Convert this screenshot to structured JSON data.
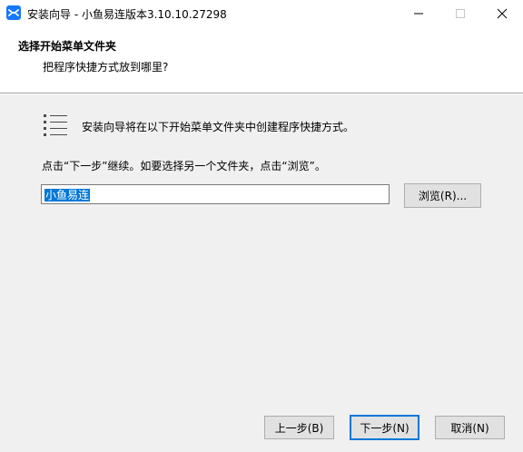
{
  "window": {
    "title": "安装向导 - 小鱼易连版本3.10.10.27298",
    "app_icon": "xylink-logo-icon",
    "accent": "#1677ff",
    "controls": {
      "minimize": "minimize-icon",
      "maximize": "maximize-icon",
      "close": "close-icon"
    }
  },
  "header": {
    "title": "选择开始菜单文件夹",
    "subtitle": "把程序快捷方式放到哪里?"
  },
  "body": {
    "icon": "start-menu-folder-list-icon",
    "intro": "安装向导将在以下开始菜单文件夹中创建程序快捷方式。",
    "instruction": "点击“下一步”继续。如要选择另一个文件夹，点击“浏览”。",
    "folder_value": "小鱼易连",
    "browse_label": "浏览(R)..."
  },
  "footer": {
    "back_label": "上一步(B)",
    "next_label": "下一步(N)",
    "cancel_label": "取消(N)"
  }
}
